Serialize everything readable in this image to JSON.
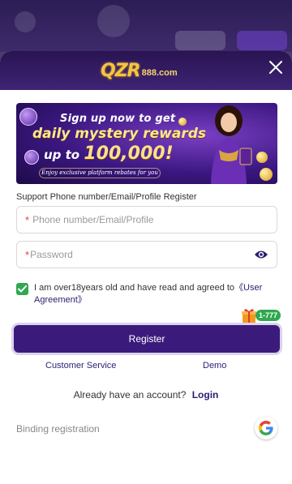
{
  "brand": {
    "logo_main": "QZR",
    "logo_suffix": "888.com"
  },
  "banner": {
    "line1": "Sign up now to get",
    "line2": "daily mystery rewards",
    "line3_prefix": "up to",
    "line3_amount": "100,000!",
    "subline": "Enjoy exclusive platform rebates for you"
  },
  "form": {
    "support_label": "Support Phone number/Email/Profile Register",
    "phone_placeholder": "Phone number/Email/Profile",
    "password_placeholder": "Password",
    "required_mark": "*",
    "agreement_text": "I am over18years old and have read and agreed to",
    "agreement_link": "《User Agreement》",
    "checked": true
  },
  "actions": {
    "register_label": "Register",
    "promo_badge": "1-777",
    "customer_service": "Customer Service",
    "demo": "Demo",
    "already_account": "Already have an account?",
    "login": "Login",
    "binding_registration": "Binding registration"
  },
  "colors": {
    "primary": "#3a1b7c",
    "link": "#2a1d70",
    "check": "#2fa84f",
    "header": "#2a1452",
    "required": "#e04343"
  },
  "icons": {
    "close": "close-icon",
    "eye": "eye-icon",
    "check": "check-icon",
    "gift": "gift-icon",
    "google": "google-icon"
  }
}
